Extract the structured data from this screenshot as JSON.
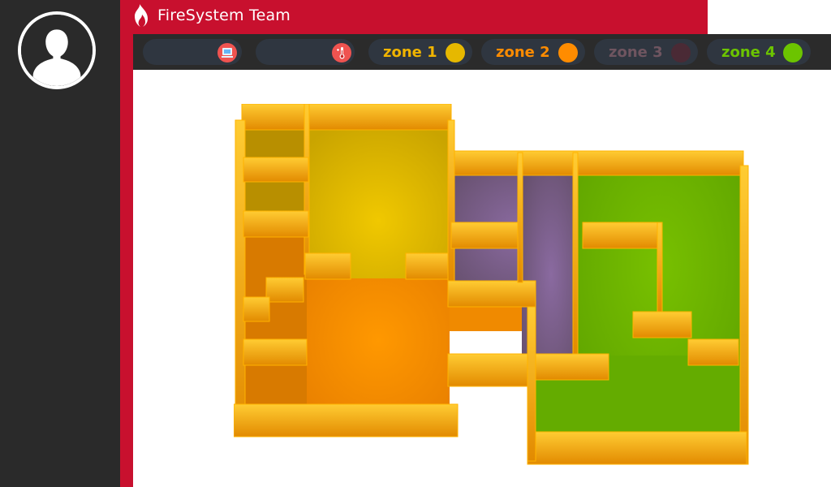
{
  "app": {
    "title": "FireSystem Team"
  },
  "toolbar": {
    "devices": [
      {
        "icon": "computer-device-icon"
      },
      {
        "icon": "thermometer-icon"
      }
    ],
    "zones": [
      {
        "label": "zone 1",
        "color": "#e6b800",
        "label_color": "#f0b400"
      },
      {
        "label": "zone 2",
        "color": "#ff8c00",
        "label_color": "#ff8c00"
      },
      {
        "label": "zone 3",
        "color": "#4a2a35",
        "label_color": "#6f5560"
      },
      {
        "label": "zone 4",
        "color": "#6cc400",
        "label_color": "#6cc400"
      }
    ]
  },
  "floorplan": {
    "zone_colors": {
      "zone1": "#e8c200",
      "zone2": "#ff8f00",
      "zone3": "#6e5a78",
      "zone4": "#6fb800",
      "wall": "#f5a400"
    }
  }
}
